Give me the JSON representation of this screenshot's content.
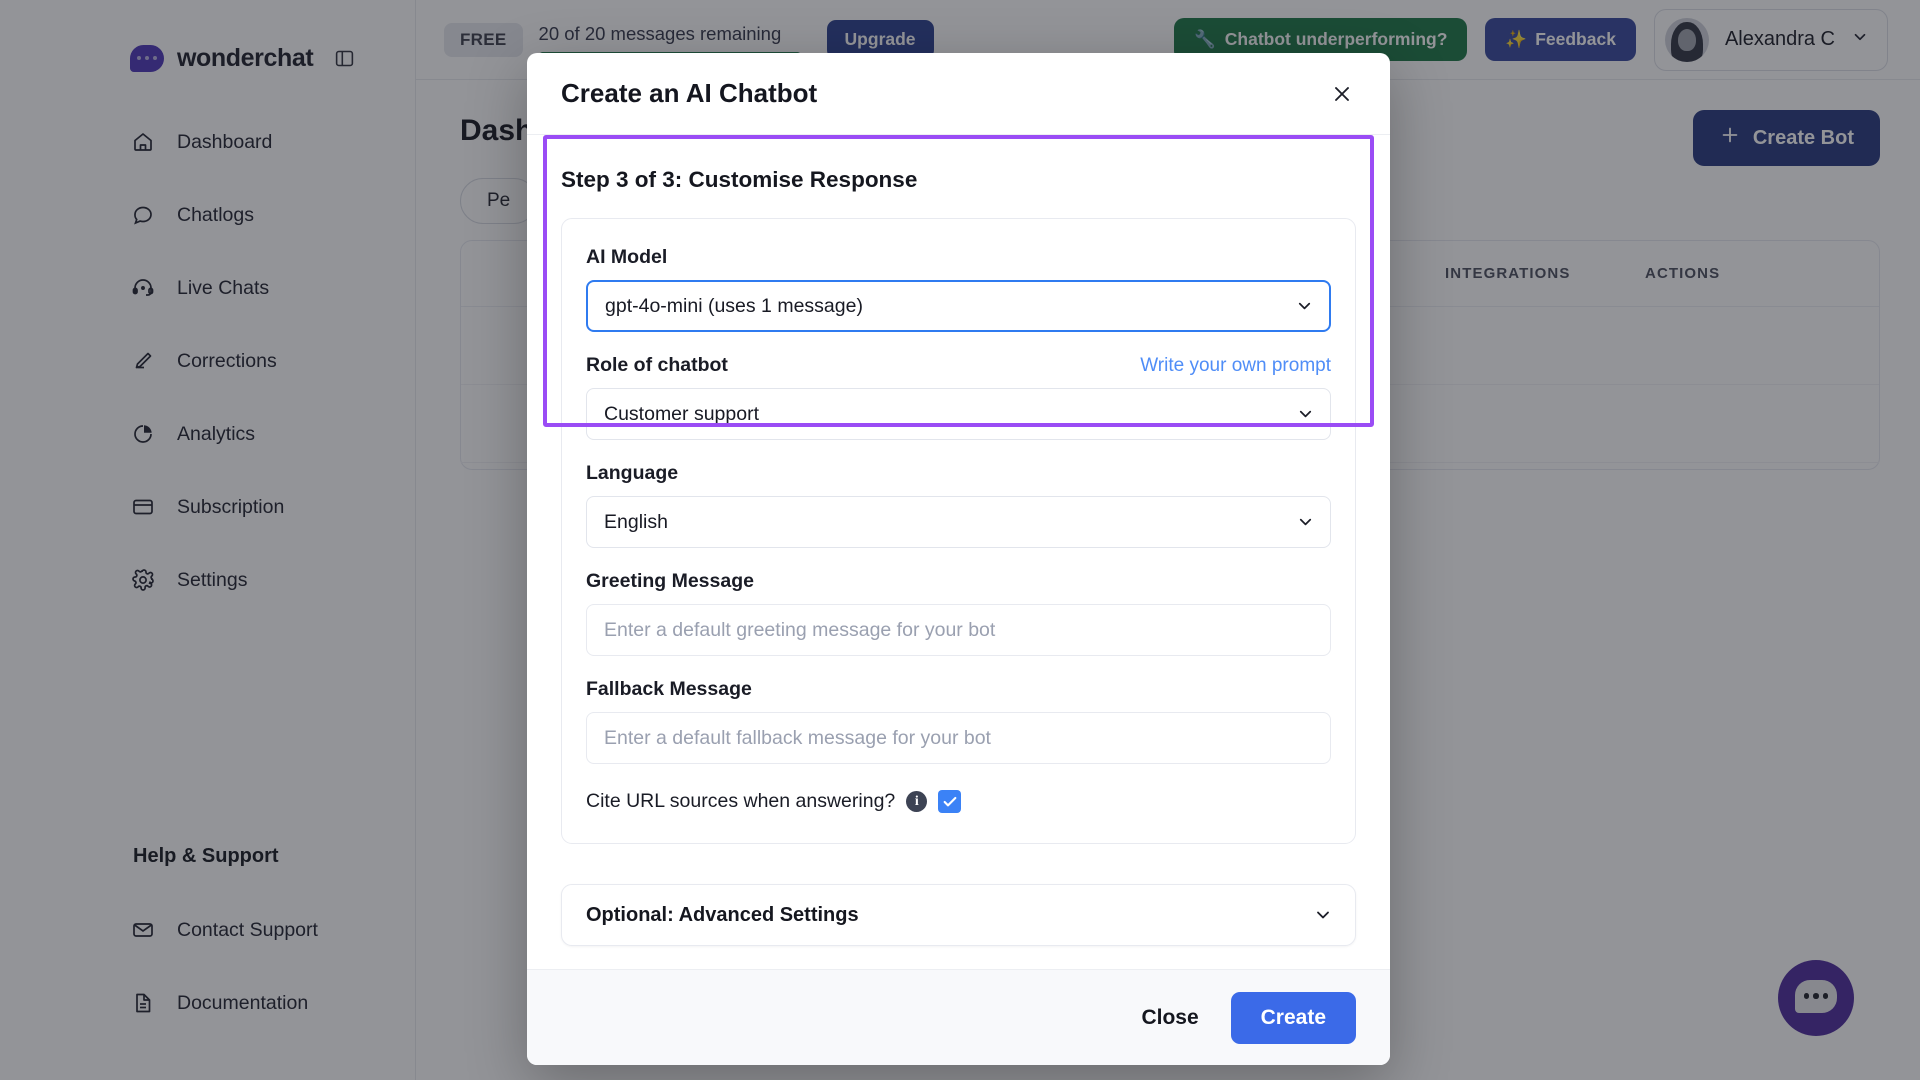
{
  "brand": {
    "name": "wonderchat",
    "logo_icon": "chat-bubble-logo",
    "sidebar_toggle_icon": "sidebar-toggle-icon"
  },
  "sidebar": {
    "items": [
      {
        "label": "Dashboard",
        "icon": "home-icon"
      },
      {
        "label": "Chatlogs",
        "icon": "speech-bubble-icon"
      },
      {
        "label": "Live Chats",
        "icon": "headset-icon"
      },
      {
        "label": "Corrections",
        "icon": "pencil-icon"
      },
      {
        "label": "Analytics",
        "icon": "pie-chart-icon"
      },
      {
        "label": "Subscription",
        "icon": "card-icon"
      },
      {
        "label": "Settings",
        "icon": "gear-icon"
      }
    ],
    "help_title": "Help & Support",
    "help_items": [
      {
        "label": "Contact Support",
        "icon": "envelope-icon"
      },
      {
        "label": "Documentation",
        "icon": "document-icon"
      }
    ]
  },
  "topbar": {
    "plan_badge": "FREE",
    "messages_text": "20 of 20 messages remaining",
    "messages_percent": 100,
    "progress_color": "#1e7a47",
    "upgrade_label": "Upgrade",
    "underperforming_label": "Chatbot underperforming?",
    "underperforming_icon": "wrench-icon",
    "feedback_label": "Feedback",
    "feedback_icon": "sparkles-icon",
    "user_name": "Alexandra C",
    "user_chevron_icon": "chevron-down-icon"
  },
  "page": {
    "title": "Dashboard",
    "filter_pill": "Pe",
    "create_bot_label": "Create Bot",
    "create_bot_icon": "plus-icon",
    "table_headers": [
      "",
      "",
      "",
      "INTEGRATIONS",
      "ACTIONS"
    ]
  },
  "chat_widget": {
    "icon": "chat-bubble-widget-icon"
  },
  "modal": {
    "title": "Create an AI Chatbot",
    "close_icon": "close-icon",
    "step_title": "Step 3 of 3: Customise Response",
    "highlight_color": "#9a4cf5",
    "fields": {
      "ai_model": {
        "label": "AI Model",
        "value": "gpt-4o-mini (uses 1 message)",
        "chevron_icon": "chevron-down-icon"
      },
      "role": {
        "label": "Role of chatbot",
        "link": "Write your own prompt",
        "value": "Customer support",
        "chevron_icon": "chevron-down-icon"
      },
      "language": {
        "label": "Language",
        "value": "English",
        "chevron_icon": "chevron-down-icon"
      },
      "greeting": {
        "label": "Greeting Message",
        "value": "",
        "placeholder": "Enter a default greeting message for your bot"
      },
      "fallback": {
        "label": "Fallback Message",
        "value": "",
        "placeholder": "Enter a default fallback message for your bot"
      },
      "cite": {
        "label": "Cite URL sources when answering?",
        "info_icon": "info-icon",
        "checked": true,
        "check_color": "#3b82f6"
      }
    },
    "advanced": {
      "label": "Optional: Advanced Settings",
      "chevron_icon": "chevron-down-icon"
    },
    "footer": {
      "close_label": "Close",
      "create_label": "Create",
      "create_color": "#3b6ae8"
    }
  }
}
